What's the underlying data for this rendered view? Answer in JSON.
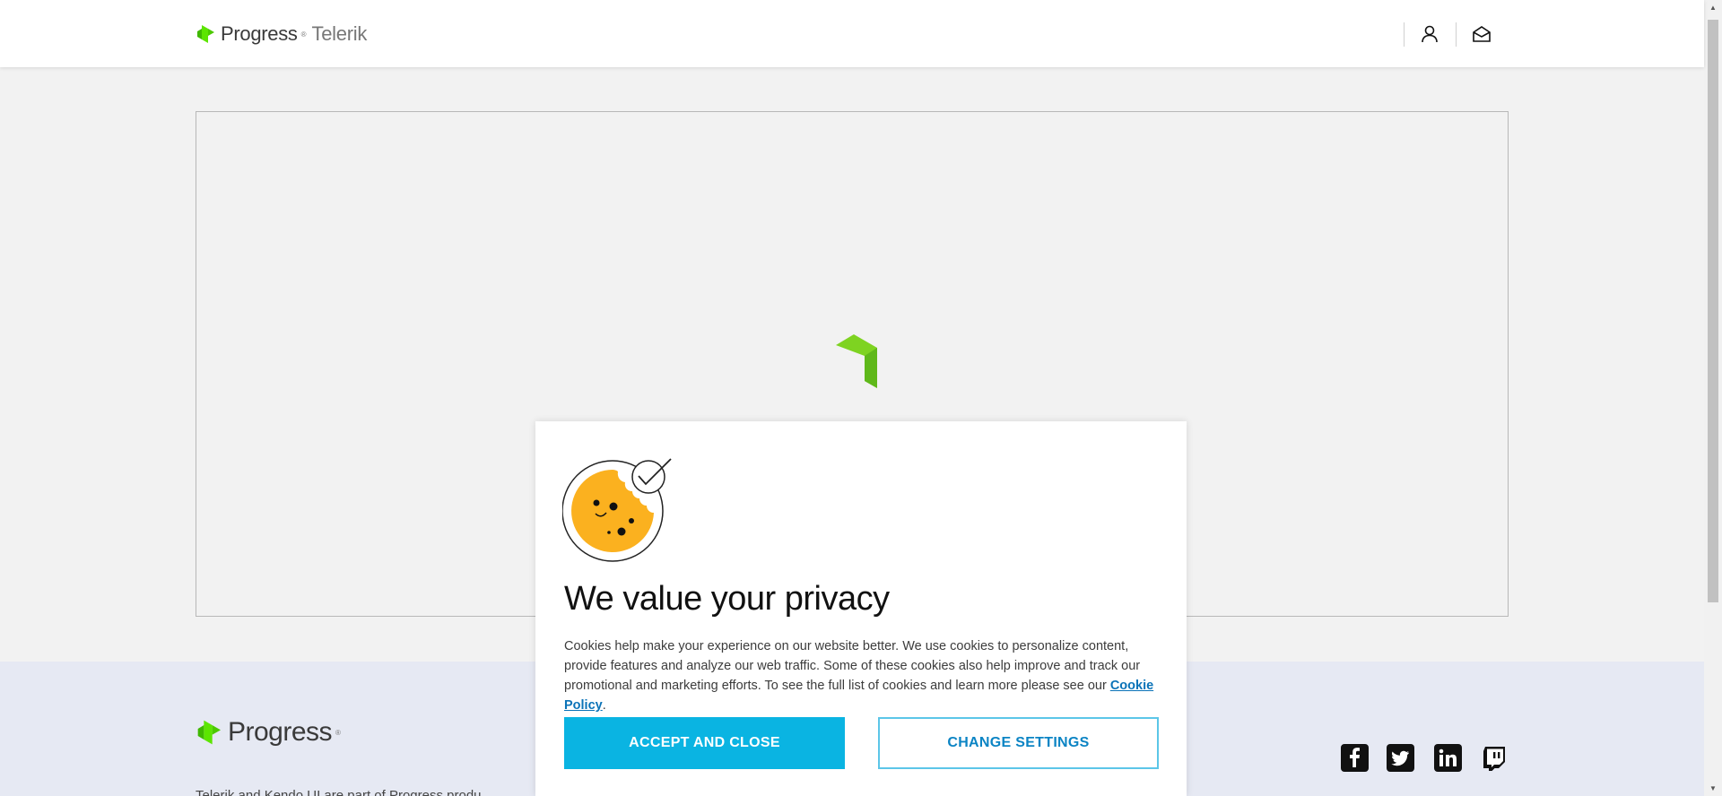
{
  "header": {
    "brand_primary": "Progress",
    "brand_secondary": "Telerik",
    "trademark": "®",
    "icons": [
      "account-icon",
      "contact-icon"
    ]
  },
  "main": {
    "loader_color": "#7ed321"
  },
  "cookie_dialog": {
    "title": "We value your privacy",
    "body_text": "Cookies help make your experience on our website better. We use cookies to personalize content, provide features and analyze our web traffic. Some of these cookies also help improve and track our promotional and marketing efforts. To see the full list of cookies and learn more please see our ",
    "policy_link": "Cookie Policy",
    "body_end": ".",
    "accept_label": "ACCEPT AND CLOSE",
    "settings_label": "CHANGE SETTINGS",
    "accent_color": "#0ab4e2"
  },
  "footer": {
    "brand": "Progress",
    "trademark": "®",
    "text": "Telerik and Kendo UI are part of Progress produ",
    "social_icons": [
      "facebook-icon",
      "twitter-icon",
      "linkedin-icon",
      "twitch-icon"
    ]
  },
  "colors": {
    "brand_green": "#5ce500",
    "header_bg": "#ffffff",
    "page_bg": "#f2f2f2",
    "footer_bg": "#e6e9f3"
  }
}
